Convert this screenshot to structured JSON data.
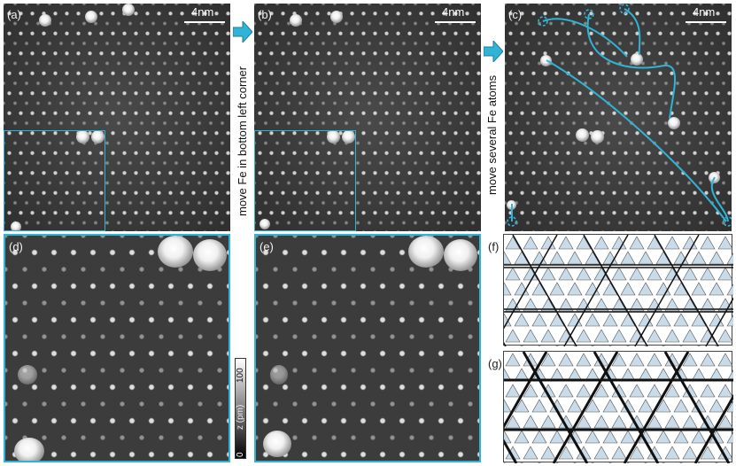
{
  "panels": {
    "a": {
      "label": "(a)",
      "scale": "4nm"
    },
    "b": {
      "label": "(b)",
      "scale": "4nm"
    },
    "c": {
      "label": "(c)",
      "scale": "4nm"
    },
    "d": {
      "label": "(d)"
    },
    "e": {
      "label": "(e)"
    },
    "f": {
      "label": "(f)"
    },
    "g": {
      "label": "(g)"
    }
  },
  "arrows": {
    "first": "move Fe in bottom left corner",
    "second": "move several Fe atoms"
  },
  "colorbar": {
    "max": "100",
    "min": "0",
    "label": "z (pm)"
  },
  "colors": {
    "accent": "#2fb3d6",
    "triangle_fill": "#c9dbe9",
    "line": "#111111"
  }
}
